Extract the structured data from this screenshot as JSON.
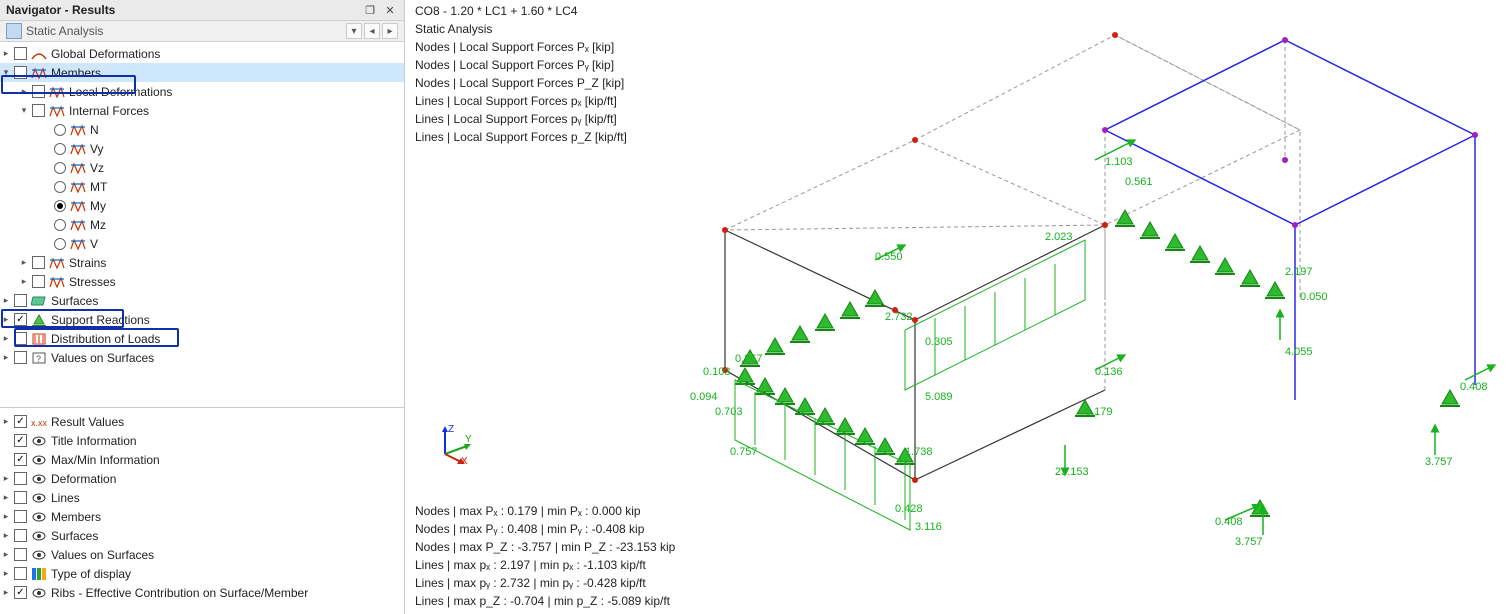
{
  "panel": {
    "title": "Navigator - Results",
    "dropdown": "Static Analysis"
  },
  "tree": {
    "global_deformations": "Global Deformations",
    "members": "Members",
    "local_deformations": "Local Deformations",
    "internal_forces": "Internal Forces",
    "n": "N",
    "vy": "Vy",
    "vz": "Vz",
    "mt": "MT",
    "my": "My",
    "mz": "Mz",
    "v": "V",
    "strains": "Strains",
    "stresses": "Stresses",
    "surfaces": "Surfaces",
    "support_reactions": "Support Reactions",
    "distribution_of_loads": "Distribution of Loads",
    "values_on_surfaces": "Values on Surfaces"
  },
  "display": {
    "result_values": "Result Values",
    "title_information": "Title Information",
    "maxmin_information": "Max/Min Information",
    "deformation": "Deformation",
    "lines": "Lines",
    "members": "Members",
    "surfaces": "Surfaces",
    "values_on_surfaces": "Values on Surfaces",
    "type_of_display": "Type of display",
    "ribs": "Ribs - Effective Contribution on Surface/Member"
  },
  "view": {
    "combo": "CO8 - 1.20 * LC1 + 1.60 * LC4",
    "analysis": "Static Analysis",
    "nodes_px": "Nodes | Local Support Forces Pₓ [kip]",
    "nodes_py": "Nodes | Local Support Forces Pᵧ [kip]",
    "nodes_pz": "Nodes | Local Support Forces P_Z [kip]",
    "lines_px": "Lines | Local Support Forces pₓ [kip/ft]",
    "lines_py": "Lines | Local Support Forces pᵧ [kip/ft]",
    "lines_pz": "Lines | Local Support Forces p_Z [kip/ft]"
  },
  "stats": {
    "n_px": "Nodes | max Pₓ : 0.179 | min Pₓ : 0.000 kip",
    "n_py": "Nodes | max Pᵧ : 0.408 | min Pᵧ : -0.408 kip",
    "n_pz": "Nodes | max P_Z : -3.757 | min P_Z : -23.153 kip",
    "l_px": "Lines | max pₓ : 2.197 | min pₓ : -1.103 kip/ft",
    "l_py": "Lines | max pᵧ : 2.732 | min pᵧ : -0.428 kip/ft",
    "l_pz": "Lines | max p_Z : -0.704 | min p_Z : -5.089 kip/ft"
  },
  "values": {
    "v1": "0.550",
    "v2": "1.103",
    "v3": "0.561",
    "v4": "2.023",
    "v5": "2.197",
    "v6": "0.050",
    "v7": "2.732",
    "v8": "0.305",
    "v9": "0.267",
    "v10": "0.103",
    "v11": "0.094",
    "v12": "0.703",
    "v13": "5.089",
    "v14": "0.136",
    "v15": "0.179",
    "v16": "4.055",
    "v17": "0.408",
    "v18": "0.757",
    "v19": "1.738",
    "v20": "23.153",
    "v21": "0.428",
    "v22": "3.116",
    "v23": "0.408",
    "v24": "3.757",
    "v25": "3.757"
  }
}
